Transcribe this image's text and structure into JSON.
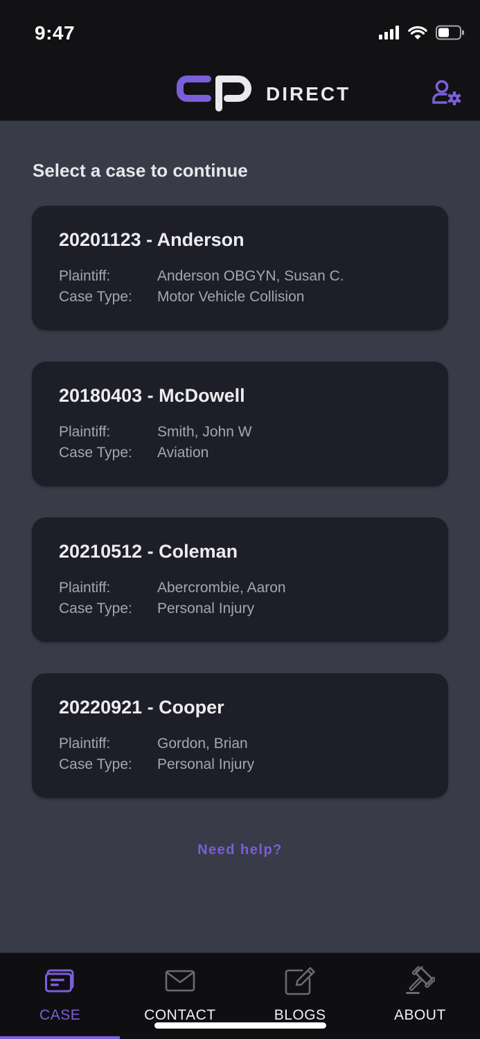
{
  "status_bar": {
    "time": "9:47"
  },
  "header": {
    "logo_text": "DIRECT",
    "accent_color": "#7b5fda"
  },
  "main": {
    "title": "Select a case to continue",
    "cases": [
      {
        "title": "20201123 - Anderson",
        "plaintiff_label": "Plaintiff:",
        "plaintiff": "Anderson OBGYN, Susan C.",
        "case_type_label": "Case Type:",
        "case_type": "Motor Vehicle Collision"
      },
      {
        "title": "20180403 - McDowell",
        "plaintiff_label": "Plaintiff:",
        "plaintiff": "Smith, John W",
        "case_type_label": "Case Type:",
        "case_type": "Aviation"
      },
      {
        "title": "20210512 - Coleman",
        "plaintiff_label": "Plaintiff:",
        "plaintiff": "Abercrombie, Aaron",
        "case_type_label": "Case Type:",
        "case_type": "Personal Injury"
      },
      {
        "title": "20220921 - Cooper",
        "plaintiff_label": "Plaintiff:",
        "plaintiff": "Gordon, Brian",
        "case_type_label": "Case Type:",
        "case_type": "Personal Injury"
      }
    ],
    "help_link": "Need help?"
  },
  "tab_bar": {
    "tabs": [
      {
        "label": "CASE",
        "icon": "case-icon",
        "active": true
      },
      {
        "label": "CONTACT",
        "icon": "mail-icon",
        "active": false
      },
      {
        "label": "BLOGS",
        "icon": "edit-icon",
        "active": false
      },
      {
        "label": "ABOUT",
        "icon": "gavel-icon",
        "active": false
      }
    ]
  }
}
